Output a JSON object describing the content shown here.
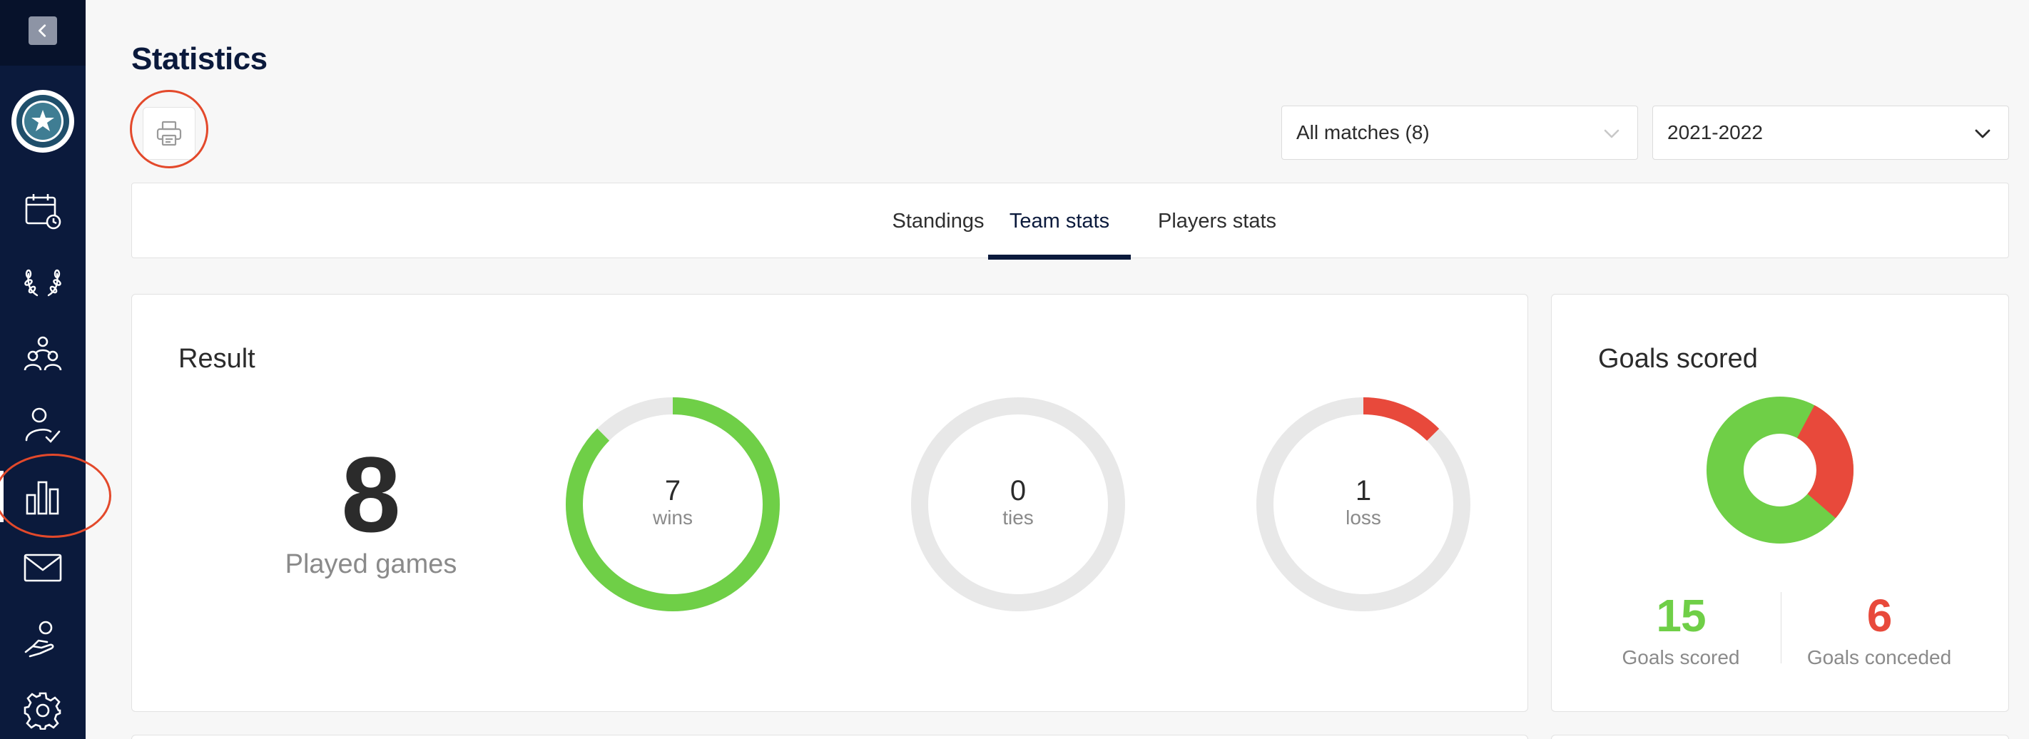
{
  "page": {
    "title": "Statistics"
  },
  "sidebar": {
    "items": [
      {
        "name": "calendar-icon"
      },
      {
        "name": "laurel-icon"
      },
      {
        "name": "team-icon"
      },
      {
        "name": "player-check-icon"
      },
      {
        "name": "bar-chart-icon",
        "active": true
      },
      {
        "name": "mail-icon"
      },
      {
        "name": "hand-heart-icon"
      },
      {
        "name": "gear-icon"
      }
    ]
  },
  "filters": {
    "matches": "All matches (8)",
    "season": "2021-2022"
  },
  "tabs": [
    {
      "label": "Standings"
    },
    {
      "label": "Team stats",
      "active": true
    },
    {
      "label": "Players stats"
    }
  ],
  "result": {
    "title": "Result",
    "played_games": "8",
    "played_label": "Played games",
    "wins": {
      "value": "7",
      "label": "wins",
      "fraction": 0.875
    },
    "ties": {
      "value": "0",
      "label": "ties",
      "fraction": 0
    },
    "loss": {
      "value": "1",
      "label": "loss",
      "fraction": 0.125
    }
  },
  "goals": {
    "title": "Goals scored",
    "scored": "15",
    "scored_label": "Goals scored",
    "conceded": "6",
    "conceded_label": "Goals conceded"
  },
  "colors": {
    "win": "#6fcf47",
    "loss": "#e8493b",
    "track": "#e8e8e8",
    "brand": "#0b1a3c"
  }
}
